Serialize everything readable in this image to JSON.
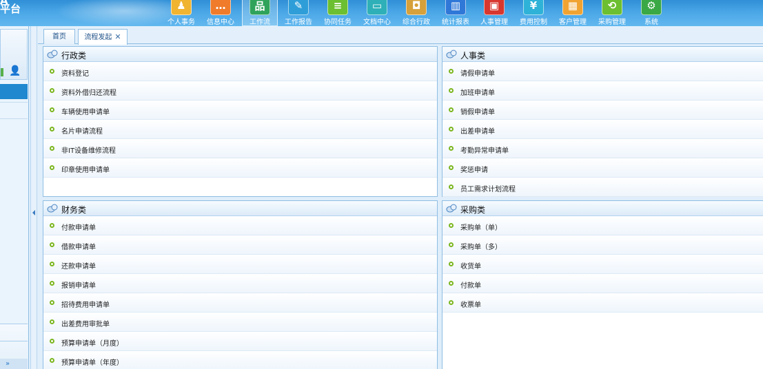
{
  "header": {
    "logo_line1": "A",
    "logo_line2": "平台",
    "nav": [
      {
        "label": "个人事务",
        "icon": "person-icon",
        "glyph": "♟",
        "color": "#f0b431"
      },
      {
        "label": "信息中心",
        "icon": "chat-icon",
        "glyph": "…",
        "color": "#f07b2a"
      },
      {
        "label": "工作流",
        "icon": "workflow-icon",
        "glyph": "品",
        "color": "#2fa35a",
        "active": true
      },
      {
        "label": "工作报告",
        "icon": "report-icon",
        "glyph": "✎",
        "color": "#2f9ed8"
      },
      {
        "label": "协同任务",
        "icon": "task-icon",
        "glyph": "≡",
        "color": "#6cbf30"
      },
      {
        "label": "文档中心",
        "icon": "document-icon",
        "glyph": "▭",
        "color": "#2fb0b8"
      },
      {
        "label": "综合行政",
        "icon": "admin-icon",
        "glyph": "◘",
        "color": "#d6a03a"
      },
      {
        "label": "统计报表",
        "icon": "chart-icon",
        "glyph": "▥",
        "color": "#2f78d8"
      },
      {
        "label": "人事管理",
        "icon": "hr-icon",
        "glyph": "▣",
        "color": "#d8372f"
      },
      {
        "label": "费用控制",
        "icon": "yuan-icon",
        "glyph": "¥",
        "color": "#2fb2d8"
      },
      {
        "label": "客户管理",
        "icon": "customer-icon",
        "glyph": "▦",
        "color": "#f0a331"
      },
      {
        "label": "采购管理",
        "icon": "purchase-icon",
        "glyph": "⟲",
        "color": "#6cbf30"
      },
      {
        "label": "系统",
        "icon": "gear-icon",
        "glyph": "⚙",
        "color": "#3aa845"
      }
    ]
  },
  "tabs": [
    {
      "label": "首页"
    },
    {
      "label": "流程发起",
      "close": "✕"
    }
  ],
  "panels": {
    "admin": {
      "title": "行政类",
      "items": [
        "资料登记",
        "资料外借归还流程",
        "车辆使用申请单",
        "名片申请流程",
        "非IT设备维修流程",
        "印章使用申请单"
      ]
    },
    "hr": {
      "title": "人事类",
      "items": [
        "请假申请单",
        "加班申请单",
        "销假申请单",
        "出差申请单",
        "考勤异常申请单",
        "奖惩申请",
        "员工需求计划流程"
      ]
    },
    "finance": {
      "title": "财务类",
      "items": [
        "付款申请单",
        "借款申请单",
        "还款申请单",
        "报销申请单",
        "招待费用申请单",
        "出差费用审批单",
        "预算申请单（月度）",
        "预算申请单（年度）"
      ]
    },
    "purchase": {
      "title": "采购类",
      "items": [
        "采购单（单）",
        "采购单（多）",
        "收货单",
        "付款单",
        "收票单"
      ]
    }
  },
  "sidebar": {
    "footer_label": "»"
  }
}
